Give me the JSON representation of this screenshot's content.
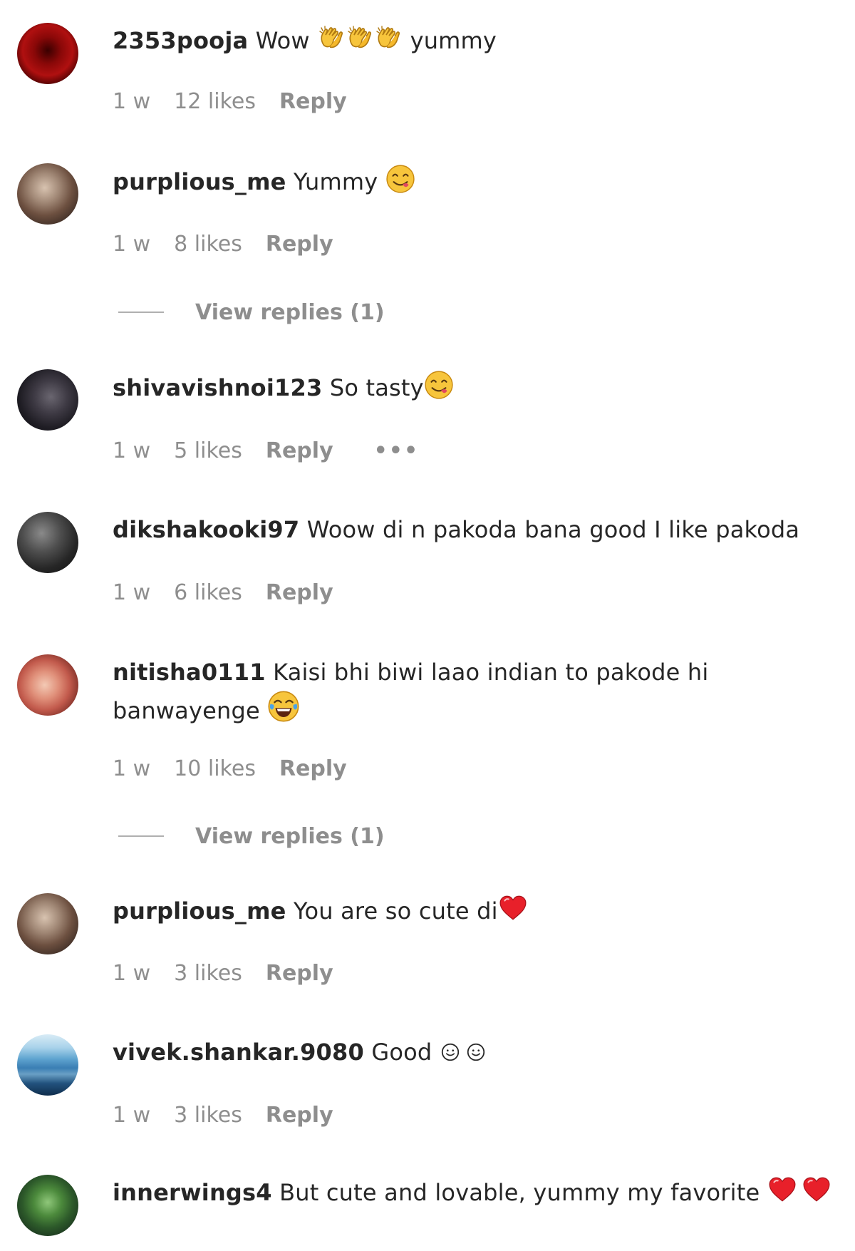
{
  "comments": [
    {
      "username": "2353pooja",
      "text": "Wow",
      "trailing_text": "yummy",
      "time": "1 w",
      "likes": "12 likes",
      "reply": "Reply",
      "emoji": [
        "clapping-hands-icon",
        "clapping-hands-icon",
        "clapping-hands-icon"
      ]
    },
    {
      "username": "purplious_me",
      "text": "Yummy",
      "time": "1 w",
      "likes": "8 likes",
      "reply": "Reply",
      "view_replies": "View replies (1)",
      "emoji": [
        "yum-face-icon"
      ]
    },
    {
      "username": "shivavishnoi123",
      "text": "So tasty",
      "time": "1 w",
      "likes": "5 likes",
      "reply": "Reply",
      "more": "•••",
      "emoji": [
        "yum-face-icon"
      ]
    },
    {
      "username": "dikshakooki97",
      "text": "Woow di n pakoda bana good I like pakoda",
      "time": "1 w",
      "likes": "6 likes",
      "reply": "Reply"
    },
    {
      "username": "nitisha0111",
      "text": "Kaisi bhi biwi laao indian to pakode hi banwayenge",
      "time": "1 w",
      "likes": "10 likes",
      "reply": "Reply",
      "view_replies": "View replies (1)",
      "emoji": [
        "tears-of-joy-icon"
      ]
    },
    {
      "username": "purplious_me",
      "text": "You are so cute di",
      "time": "1 w",
      "likes": "3 likes",
      "reply": "Reply",
      "emoji": [
        "red-heart-icon"
      ]
    },
    {
      "username": "vivek.shankar.9080",
      "text": "Good",
      "time": "1 w",
      "likes": "3 likes",
      "reply": "Reply",
      "emoji": [
        "smiley-outline-icon",
        "smiley-outline-icon"
      ]
    },
    {
      "username": "innerwings4",
      "text": "But cute and lovable, yummy my favorite",
      "emoji": [
        "red-heart-icon",
        "red-heart-icon"
      ]
    }
  ],
  "colors": {
    "text_primary": "#262626",
    "text_secondary": "#8e8e8e",
    "background": "#ffffff",
    "heart": "#e8202a",
    "emoji_yellow": "#f7c53c"
  }
}
